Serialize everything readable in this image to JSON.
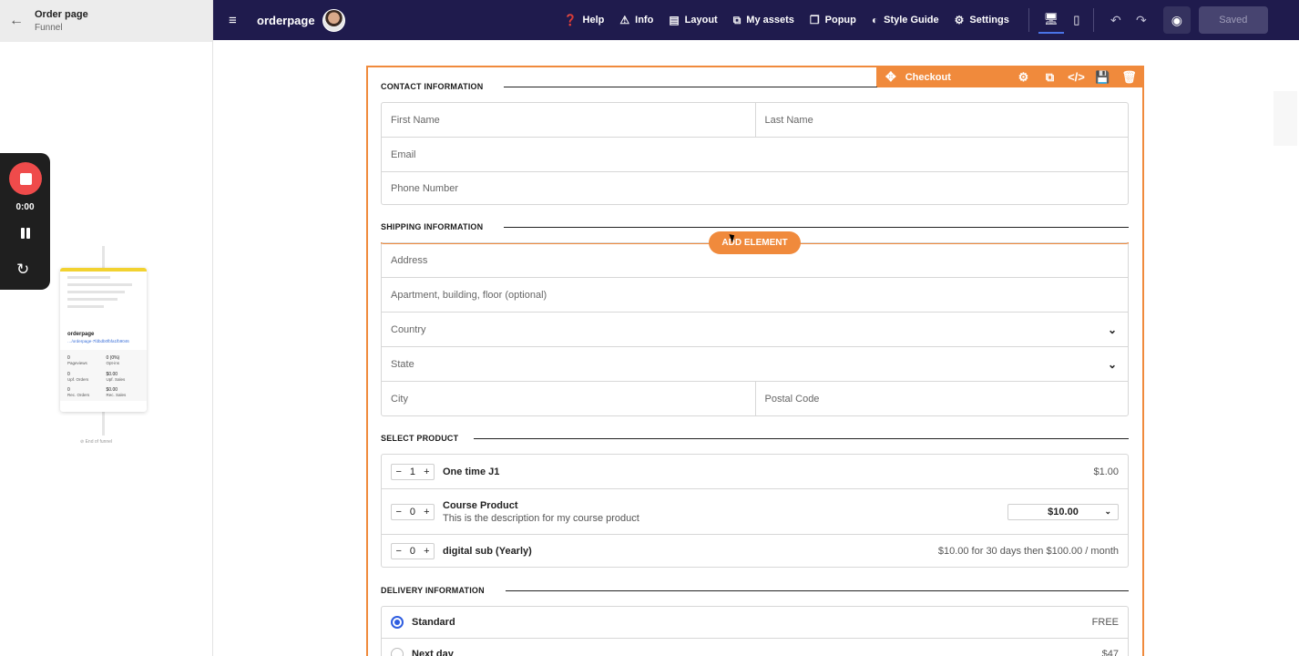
{
  "left_panel": {
    "back_icon": "arrow-left-icon",
    "title": "Order page",
    "subtitle": "Funnel",
    "recorder": {
      "time": "0:00"
    },
    "funnel_card": {
      "name": "orderpage",
      "url": "…/orderpage-7fdbdb0fbfa1fb9046",
      "stats": [
        {
          "value": "0",
          "label": "Pageviews"
        },
        {
          "value": "0 (0%)",
          "label": "Opt-ins"
        },
        {
          "value": "0",
          "label": "Upf. Orders"
        },
        {
          "value": "$0.00",
          "label": "Upf. Sales"
        },
        {
          "value": "0",
          "label": "Rec. Orders"
        },
        {
          "value": "$0.00",
          "label": "Rec. Sales"
        }
      ],
      "end_label": "End of funnel"
    }
  },
  "topbar": {
    "brand": "orderpage",
    "items": [
      {
        "label": "Help",
        "icon": "help-circle-icon",
        "glyph": "❓"
      },
      {
        "label": "Info",
        "icon": "warning-triangle-icon",
        "glyph": "⚠"
      },
      {
        "label": "Layout",
        "icon": "layout-icon",
        "glyph": "▤"
      },
      {
        "label": "My assets",
        "icon": "assets-icon",
        "glyph": "⧉"
      },
      {
        "label": "Popup",
        "icon": "popup-icon",
        "glyph": "❐"
      },
      {
        "label": "Style Guide",
        "icon": "palette-icon",
        "glyph": "◐"
      },
      {
        "label": "Settings",
        "icon": "settings-icon",
        "glyph": "⚙"
      }
    ],
    "saved_label": "Saved"
  },
  "checkout": {
    "toolbar_label": "Checkout",
    "contact": {
      "title": "CONTACT INFORMATION",
      "first_name": "First Name",
      "last_name": "Last Name",
      "email": "Email",
      "phone": "Phone Number"
    },
    "shipping": {
      "title": "SHIPPING INFORMATION",
      "add_element": "ADD ELEMENT",
      "address": "Address",
      "apartment": "Apartment, building, floor (optional)",
      "country": "Country",
      "state": "State",
      "city": "City",
      "postal": "Postal Code"
    },
    "products": {
      "title": "SELECT PRODUCT",
      "items": [
        {
          "qty": "1",
          "name": "One time J1",
          "description": "",
          "price": "$1.00"
        },
        {
          "qty": "0",
          "name": "Course Product",
          "description": "This is the description for my course product",
          "price_option": "$10.00"
        },
        {
          "qty": "0",
          "name": "digital sub (Yearly)",
          "description": "",
          "price": "$10.00 for 30 days then $100.00 / month"
        }
      ]
    },
    "delivery": {
      "title": "DELIVERY INFORMATION",
      "options": [
        {
          "name": "Standard",
          "price": "FREE",
          "selected": true
        },
        {
          "name": "Next day",
          "price": "$47",
          "selected": false
        }
      ]
    }
  },
  "colors": {
    "topbar": "#1f1b4d",
    "accent": "#f08a3c",
    "radio": "#2f5ee0"
  }
}
